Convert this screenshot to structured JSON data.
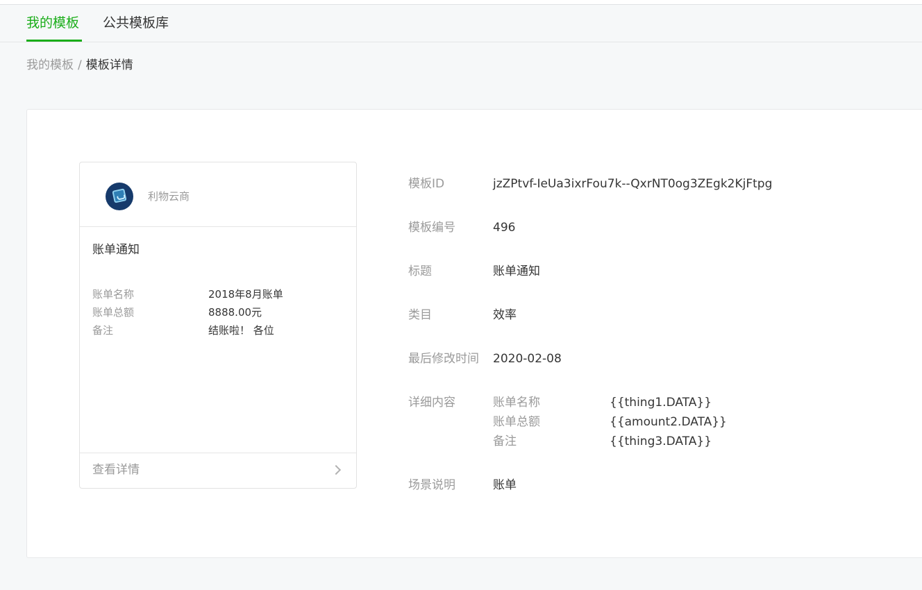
{
  "tabs": [
    {
      "label": "我的模板",
      "active": true
    },
    {
      "label": "公共模板库",
      "active": false
    }
  ],
  "breadcrumb": {
    "parent": "我的模板",
    "separator": "/",
    "current": "模板详情"
  },
  "preview": {
    "account_name": "利物云商",
    "title": "账单通知",
    "fields": [
      {
        "name": "账单名称",
        "value": "2018年8月账单"
      },
      {
        "name": "账单总额",
        "value": "8888.00元"
      },
      {
        "name": "备注",
        "value": "结账啦！ 各位"
      }
    ],
    "footer_label": "查看详情"
  },
  "details": {
    "template_id": {
      "label": "模板ID",
      "value": "jzZPtvf-IeUa3ixrFou7k--QxrNT0og3ZEgk2KjFtpg"
    },
    "template_no": {
      "label": "模板编号",
      "value": "496"
    },
    "title": {
      "label": "标题",
      "value": "账单通知"
    },
    "category": {
      "label": "类目",
      "value": "效率"
    },
    "modified": {
      "label": "最后修改时间",
      "value": "2020-02-08"
    },
    "content": {
      "label": "详细内容",
      "rows": [
        {
          "name": "账单名称",
          "value": "{{thing1.DATA}}"
        },
        {
          "name": "账单总额",
          "value": "{{amount2.DATA}}"
        },
        {
          "name": "备注",
          "value": "{{thing3.DATA}}"
        }
      ]
    },
    "scene": {
      "label": "场景说明",
      "value": "账单"
    }
  },
  "colors": {
    "accent": "#1aad19",
    "text": "#353535",
    "muted": "#9a9a9a",
    "background": "#f6f8f9"
  }
}
